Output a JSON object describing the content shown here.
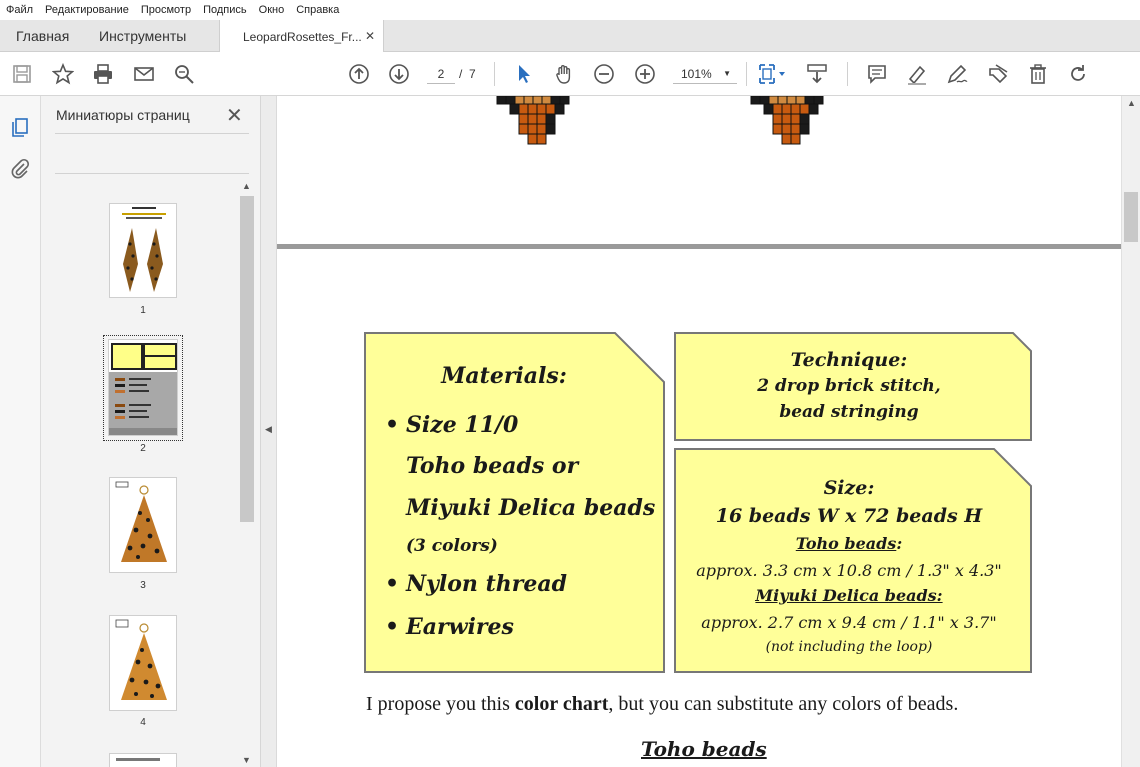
{
  "menubar": {
    "items": [
      "Файл",
      "Редактирование",
      "Просмотр",
      "Подпись",
      "Окно",
      "Справка"
    ]
  },
  "tabs": {
    "home": "Главная",
    "tools": "Инструменты",
    "document": "LeopardRosettes_Fr...",
    "close": "✕"
  },
  "toolbar": {
    "page_current": "2",
    "page_separator": "/",
    "page_total": "7",
    "zoom": "101%",
    "zoom_arrow": "▼",
    "icons": [
      "save-icon",
      "star-icon",
      "print-icon",
      "email-icon",
      "search-zoom-icon",
      "page-up-icon",
      "page-down-icon",
      "select-cursor-icon",
      "hand-icon",
      "zoom-out-icon",
      "zoom-in-icon",
      "fit-page-icon",
      "scroll-mode-icon",
      "comment-icon",
      "highlight-icon",
      "sign-icon",
      "edit-stamp-icon",
      "delete-icon",
      "rotate-icon"
    ]
  },
  "sidebar": {
    "title": "Миниатюры страниц",
    "close": "✕",
    "thumbnails": [
      {
        "label": "1"
      },
      {
        "label": "2"
      },
      {
        "label": "3"
      },
      {
        "label": "4"
      }
    ]
  },
  "document": {
    "materials": {
      "heading": "Materials:",
      "item1_line1": "Size 11/0",
      "item1_line2": "Toho beads or",
      "item1_line3": "Miyuki Delica beads",
      "item1_line4": "(3 colors)",
      "item2": "Nylon thread",
      "item3": "Earwires"
    },
    "technique": {
      "heading": "Technique:",
      "line1": "2 drop brick stitch,",
      "line2": "bead stringing"
    },
    "size": {
      "heading": "Size:",
      "dims": "16 beads W x 72 beads H",
      "toho_label": "Toho beads",
      "toho_colon": ":",
      "toho_value": "approx. 3.3 cm x 10.8 cm / 1.3\" x 4.3\"",
      "miyuki_label": "Miyuki Delica beads:",
      "miyuki_value": "approx. 2.7 cm x 9.4 cm / 1.1\" x 3.7\"",
      "note": "(not including the loop)"
    },
    "body_pre": "I propose you this ",
    "body_bold": "color chart",
    "body_post": ", but you can substitute any colors of beads.",
    "toho_heading": "Toho beads"
  },
  "colors": {
    "box_fill": "#ffff99",
    "box_border": "#777777",
    "bead_orange": "#c75a10",
    "bead_dark": "#1a1a1a",
    "bead_tan": "#d08a40"
  }
}
